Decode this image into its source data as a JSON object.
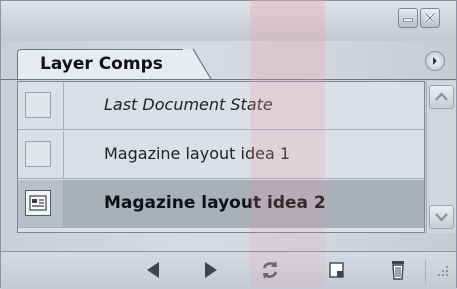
{
  "panel": {
    "tab_label": "Layer Comps",
    "window_buttons": {
      "minimize_icon": "minimize-icon",
      "close_icon": "close-icon"
    },
    "menu_icon": "panel-menu-arrow-icon"
  },
  "comps": [
    {
      "label": "Last Document State",
      "selected": false,
      "style": "italic",
      "has_thumbnail_icon": false
    },
    {
      "label": "Magazine layout idea 1",
      "selected": false,
      "style": "normal",
      "has_thumbnail_icon": false
    },
    {
      "label": "Magazine layout idea 2",
      "selected": true,
      "style": "bold",
      "has_thumbnail_icon": true
    }
  ],
  "toolbar": {
    "buttons": [
      {
        "icon": "previous-icon"
      },
      {
        "icon": "next-icon"
      },
      {
        "icon": "update-icon"
      },
      {
        "icon": "new-comp-icon"
      },
      {
        "icon": "trash-icon"
      }
    ]
  },
  "colors": {
    "selected_row": "#a9b0b9",
    "panel_bg": "#d2d6dd",
    "accent_wash": "#e28492"
  }
}
